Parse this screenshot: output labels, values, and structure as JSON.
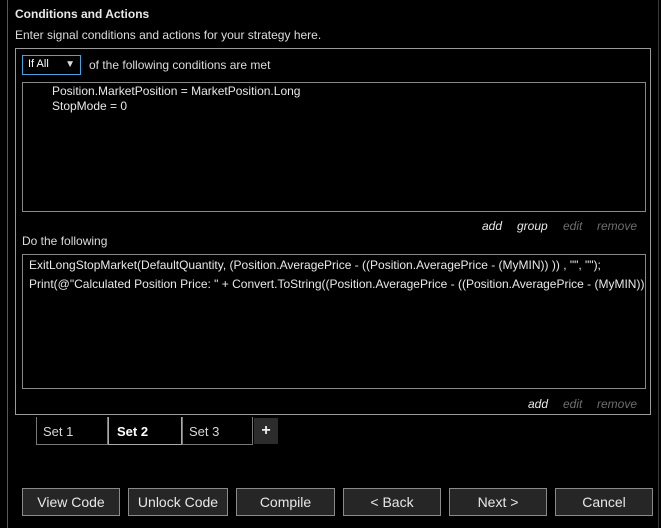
{
  "header": {
    "title": "Conditions and Actions",
    "subtitle": "Enter signal conditions and actions for your strategy here."
  },
  "conditions": {
    "mode_select": "If All",
    "mode_label": "of the following conditions are met",
    "lines": [
      "Position.MarketPosition = MarketPosition.Long",
      "StopMode = 0"
    ],
    "links": {
      "add": "add",
      "group": "group",
      "edit": "edit",
      "remove": "remove"
    }
  },
  "actions": {
    "label": "Do the following",
    "lines": [
      "ExitLongStopMarket(DefaultQuantity, (Position.AveragePrice - ((Position.AveragePrice - (MyMIN)) )) , \"\", \"\");",
      "Print(@\"Calculated Position Price: \" + Convert.ToString((Position.AveragePrice - ((Position.AveragePrice - (MyMIN)) )) ));"
    ],
    "links": {
      "add": "add",
      "edit": "edit",
      "remove": "remove"
    }
  },
  "tabs": [
    {
      "label": "Set 1",
      "active": false
    },
    {
      "label": "Set 2",
      "active": true
    },
    {
      "label": "Set 3",
      "active": false
    }
  ],
  "tab_add": "+",
  "footer": {
    "view_code": "View Code",
    "unlock_code": "Unlock Code",
    "compile": "Compile",
    "back": "< Back",
    "next": "Next >",
    "cancel": "Cancel"
  },
  "colors": {
    "accent": "#4aa3df",
    "background": "#000000",
    "button_bg": "#262626"
  }
}
